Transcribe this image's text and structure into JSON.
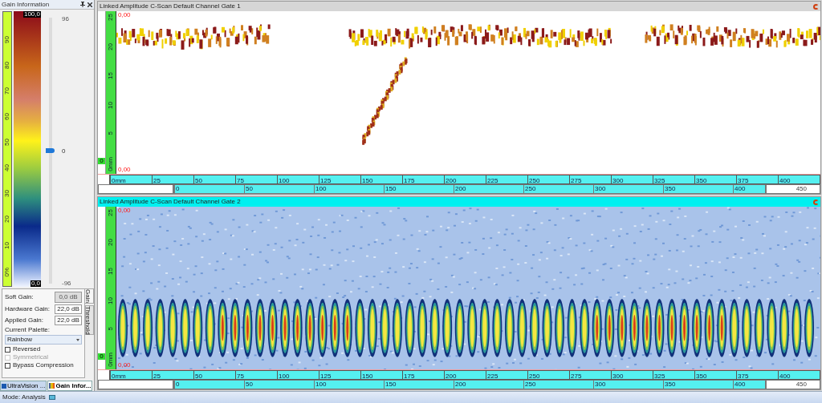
{
  "gain_panel": {
    "title": "Gain Information",
    "scale_labels": [
      "90",
      "80",
      "70",
      "60",
      "50",
      "40",
      "30",
      "20",
      "10",
      "0%"
    ],
    "palette_max": "100,0",
    "palette_min": "0,0",
    "slider": {
      "max": "96",
      "value": "0",
      "min": "-96",
      "level": 0.5
    },
    "fields": [
      {
        "label": "Soft Gain:",
        "value": "0,0 dB",
        "disabled": true
      },
      {
        "label": "Hardware Gain:",
        "value": "22,0 dB",
        "disabled": false
      },
      {
        "label": "Applied Gain:",
        "value": "22,0 dB",
        "disabled": false
      }
    ],
    "palette": {
      "label": "Current Palette:",
      "value": "Rainbow"
    },
    "options": [
      {
        "label": "Reversed",
        "checked": false,
        "disabled": false
      },
      {
        "label": "Symmetrical",
        "checked": false,
        "disabled": true
      },
      {
        "label": "Bypass Compression",
        "checked": false,
        "disabled": false
      }
    ],
    "side_tabs": [
      {
        "label": "Gain",
        "selected": true
      },
      {
        "label": "Threshold",
        "selected": false
      }
    ]
  },
  "dock_tabs": [
    {
      "label": "UltraVision ...",
      "selected": false,
      "kind": "app"
    },
    {
      "label": "Gain Infor...",
      "selected": true,
      "kind": "palette"
    }
  ],
  "views": [
    {
      "title": "Linked Amplitude C-Scan Default Channel Gate 1",
      "selected": false,
      "kind": "sparse",
      "top_value": "0,00",
      "bottom_value": "0,00",
      "index_marker": "0",
      "depth_labels": [
        "25",
        "20",
        "15",
        "10",
        "5",
        "0mm"
      ],
      "scan_axis": [
        "0mm",
        "25",
        "50",
        "75",
        "100",
        "125",
        "150",
        "175",
        "200",
        "225",
        "250",
        "275",
        "300",
        "325",
        "350",
        "375",
        "400"
      ],
      "index_axis": [
        "0",
        "50",
        "100",
        "150",
        "200",
        "250",
        "300",
        "350",
        "400"
      ],
      "index_axis_end": "450"
    },
    {
      "title": "Linked Amplitude C-Scan Default Channel Gate 2",
      "selected": true,
      "kind": "dense",
      "top_value": "0,00",
      "bottom_value": "0,00",
      "index_marker": "0",
      "depth_labels": [
        "25",
        "20",
        "15",
        "10",
        "5",
        "0mm"
      ],
      "scan_axis": [
        "0mm",
        "25",
        "50",
        "75",
        "100",
        "125",
        "150",
        "175",
        "200",
        "225",
        "250",
        "275",
        "300",
        "325",
        "350",
        "375",
        "400"
      ],
      "index_axis": [
        "0",
        "50",
        "100",
        "150",
        "200",
        "250",
        "300",
        "350",
        "400"
      ],
      "index_axis_end": "450"
    }
  ],
  "status_bar": {
    "mode": "Mode: Analysis"
  }
}
